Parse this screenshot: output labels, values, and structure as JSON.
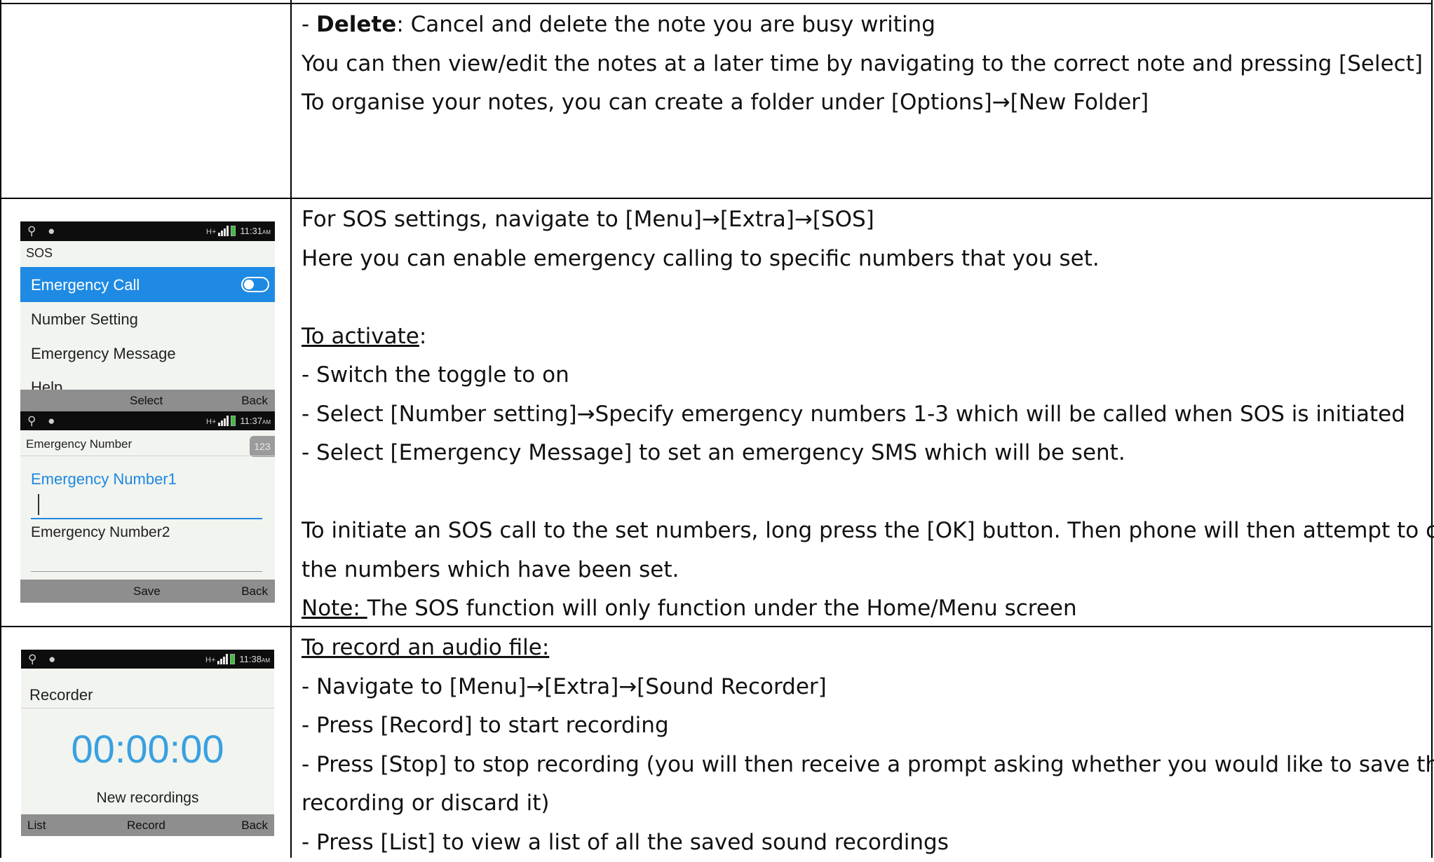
{
  "rows": [
    {
      "lines": [
        {
          "prefix": "- ",
          "bold": "Delete",
          "rest": ": Cancel and delete the note you are busy writing"
        },
        {
          "text": "You can then view/edit the notes at a later time by navigating to the correct note and pressing [Select]"
        },
        {
          "text": "To organise your notes, you can create a folder under [Options]→[New Folder]"
        }
      ]
    },
    {
      "lines": [
        {
          "text": "For SOS settings, navigate to [Menu]→[Extra]→[SOS]"
        },
        {
          "text": "Here you can enable emergency calling to specific numbers that you set."
        },
        {
          "underlined": "To activate",
          "rest": ":"
        },
        {
          "text": "- Switch the toggle to on"
        },
        {
          "text": "- Select [Number setting]→Specify emergency numbers 1-3 which will be called when SOS is initiated"
        },
        {
          "text": "- Select [Emergency Message] to set an emergency SMS which will be sent."
        },
        {
          "text": "To initiate an SOS call to the set numbers, long press the [OK] button. Then phone will then attempt to call"
        },
        {
          "text": "the numbers which have been set."
        },
        {
          "underlined": "Note: ",
          "rest": "The SOS function will only function under the Home/Menu screen"
        }
      ]
    },
    {
      "lines": [
        {
          "underlined": "To record an audio file:"
        },
        {
          "text": "- Navigate to [Menu]→[Extra]→[Sound Recorder]"
        },
        {
          "text": "- Press [Record] to start recording"
        },
        {
          "text": "- Press [Stop] to stop recording (you will then receive a prompt asking whether you would like to save the"
        },
        {
          "text": "recording or discard it)"
        },
        {
          "text": "- Press [List] to view a list of all the saved sound recordings"
        }
      ]
    }
  ],
  "phones": {
    "sos": {
      "clock": "11:31",
      "clock_suffix": "AM",
      "network": "H+",
      "title": "SOS",
      "selected_item": "Emergency Call",
      "items": [
        "Number Setting",
        "Emergency Message",
        "Help"
      ],
      "softkey_center": "Select",
      "softkey_right": "Back"
    },
    "emergency_number": {
      "clock": "11:37",
      "clock_suffix": "AM",
      "network": "H+",
      "title": "Emergency Number",
      "badge": "123",
      "field1_label": "Emergency Number1",
      "field2_label": "Emergency Number2",
      "softkey_center": "Save",
      "softkey_right": "Back"
    },
    "recorder": {
      "clock": "11:38",
      "clock_suffix": "AM",
      "network": "H+",
      "title": "Recorder",
      "timer": "00:00:00",
      "caption": "New recordings",
      "softkey_left": "List",
      "softkey_center": "Record",
      "softkey_right": "Back"
    }
  },
  "colors": {
    "accent_blue": "#1f8ae3",
    "timer_blue": "#3aa0e0",
    "softkey_bar": "#8e8e8e",
    "status_bar": "#0d0d0d"
  }
}
